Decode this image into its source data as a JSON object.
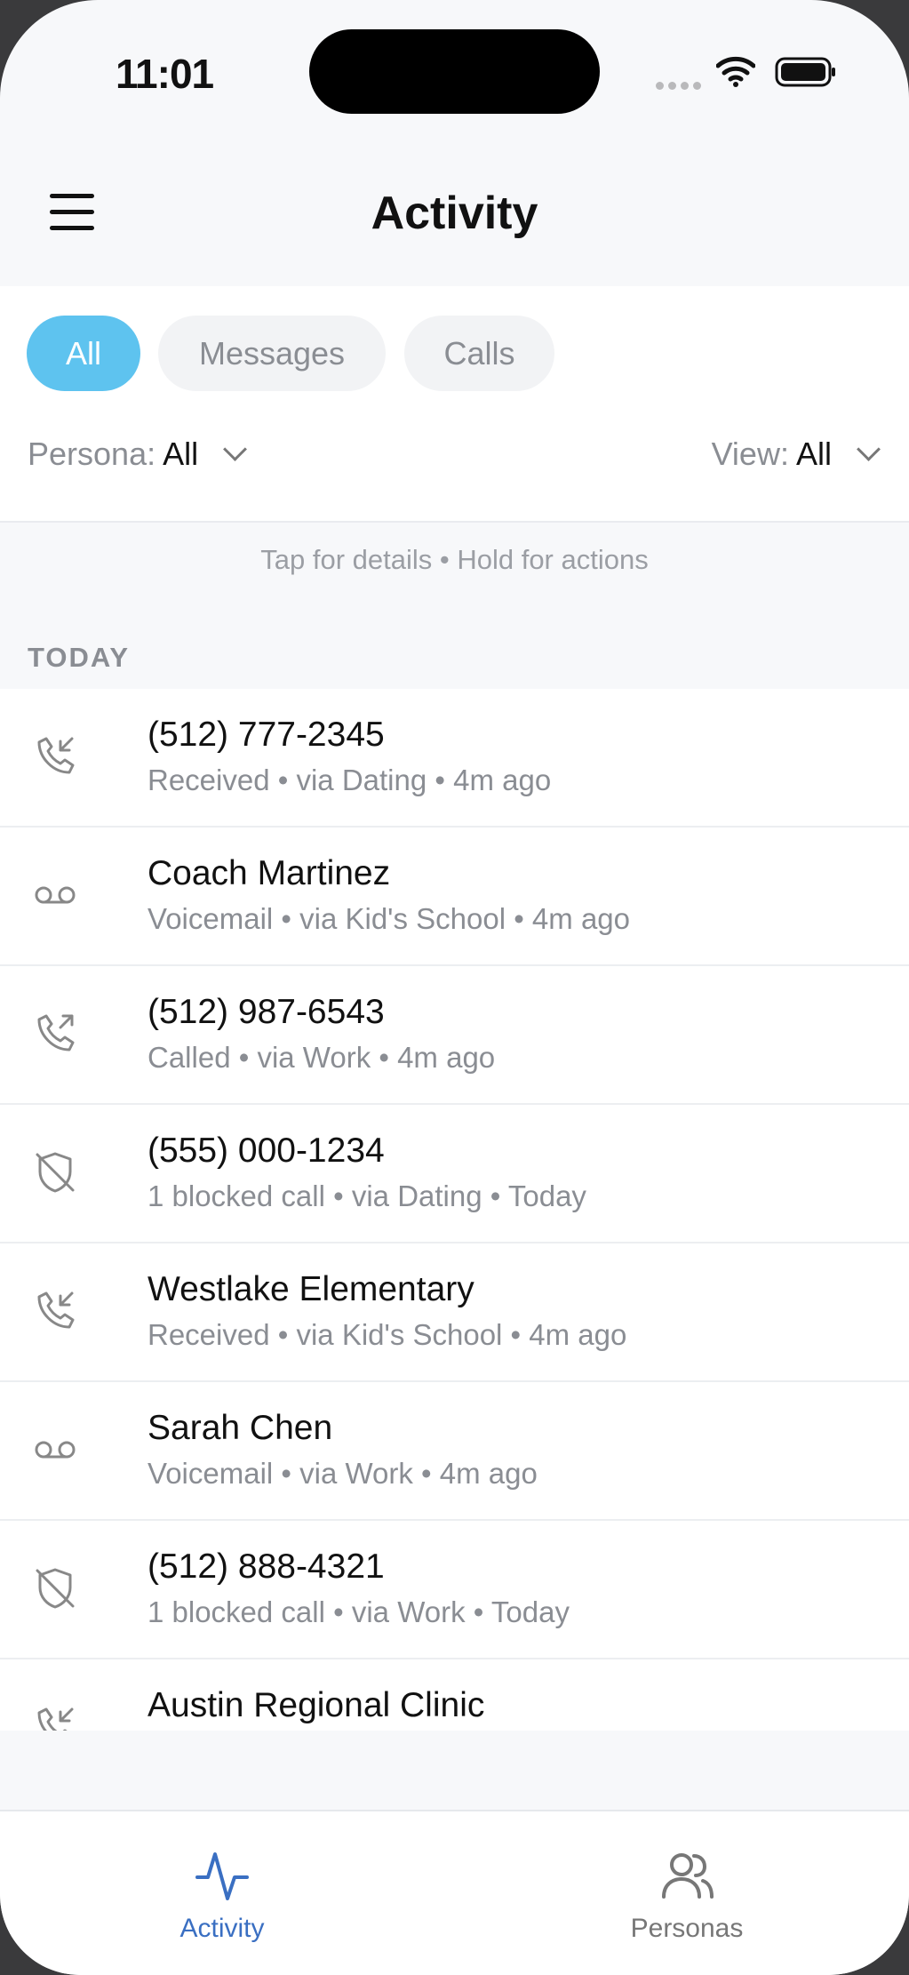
{
  "status_bar": {
    "time": "11:01"
  },
  "header": {
    "title": "Activity"
  },
  "filters": {
    "chips": [
      {
        "label": "All",
        "active": true
      },
      {
        "label": "Messages",
        "active": false
      },
      {
        "label": "Calls",
        "active": false
      }
    ],
    "persona_label": "Persona:",
    "persona_value": "All",
    "view_label": "View:",
    "view_value": "All"
  },
  "hint": "Tap for details • Hold for actions",
  "section_title": "TODAY",
  "items": [
    {
      "icon": "incoming-call-icon",
      "name": "(512) 777-2345",
      "meta": "Received • via Dating • 4m ago"
    },
    {
      "icon": "voicemail-icon",
      "name": "Coach Martinez",
      "meta": "Voicemail • via Kid's School • 4m ago"
    },
    {
      "icon": "outgoing-call-icon",
      "name": "(512) 987-6543",
      "meta": "Called • via Work • 4m ago"
    },
    {
      "icon": "blocked-shield-icon",
      "name": "(555) 000-1234",
      "meta": "1 blocked call • via Dating • Today"
    },
    {
      "icon": "incoming-call-icon",
      "name": "Westlake Elementary",
      "meta": "Received • via Kid's School • 4m ago"
    },
    {
      "icon": "voicemail-icon",
      "name": "Sarah Chen",
      "meta": "Voicemail • via Work • 4m ago"
    },
    {
      "icon": "blocked-shield-icon",
      "name": "(512) 888-4321",
      "meta": "1 blocked call • via Work • Today"
    },
    {
      "icon": "incoming-call-icon",
      "name": "Austin Regional Clinic",
      "meta": ""
    }
  ],
  "tabs": [
    {
      "label": "Activity",
      "icon": "activity-pulse-icon",
      "active": true
    },
    {
      "label": "Personas",
      "icon": "people-icon",
      "active": false
    }
  ],
  "colors": {
    "accent": "#5ec3ef",
    "tab_active": "#3a6fc2",
    "muted": "#8a8d93"
  }
}
